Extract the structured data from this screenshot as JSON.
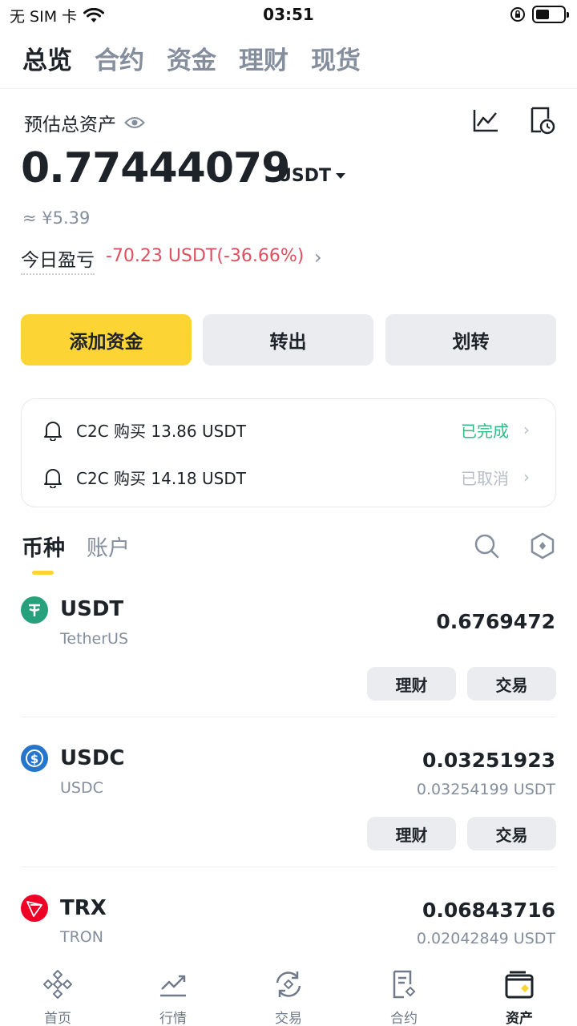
{
  "status_bar": {
    "carrier": "无 SIM 卡",
    "time": "03:51"
  },
  "top_tabs": [
    {
      "label": "总览",
      "active": true
    },
    {
      "label": "合约",
      "active": false
    },
    {
      "label": "资金",
      "active": false
    },
    {
      "label": "理财",
      "active": false
    },
    {
      "label": "现货",
      "active": false
    }
  ],
  "overview": {
    "estimated_label": "预估总资产",
    "total_amount": "0.77444079",
    "unit": "USDT",
    "approx_cny": "≈ ¥5.39",
    "today_pnl_label": "今日盈亏",
    "today_pnl_value": "-70.23 USDT(-36.66%)"
  },
  "actions": {
    "add_funds": "添加资金",
    "withdraw": "转出",
    "transfer": "划转"
  },
  "notices": [
    {
      "text": "C2C 购买 13.86 USDT",
      "status": "已完成",
      "status_color": "#2ebd85"
    },
    {
      "text": "C2C 购买 14.18 USDT",
      "status": "已取消",
      "status_color": "#b7bdc6"
    }
  ],
  "section_tabs": {
    "coins": "币种",
    "accounts": "账户"
  },
  "coins": [
    {
      "symbol": "USDT",
      "name": "TetherUS",
      "balance": "0.6769472",
      "value": "",
      "earn": "理财",
      "trade": "交易",
      "color": "#26a17b"
    },
    {
      "symbol": "USDC",
      "name": "USDC",
      "balance": "0.03251923",
      "value": "0.03254199 USDT",
      "earn": "理财",
      "trade": "交易",
      "color": "#2775ca"
    },
    {
      "symbol": "TRX",
      "name": "TRON",
      "balance": "0.06843716",
      "value": "0.02042849 USDT",
      "color": "#ef0027"
    }
  ],
  "bottom_nav": [
    {
      "label": "首页",
      "icon": "home-icon"
    },
    {
      "label": "行情",
      "icon": "market-chart-icon"
    },
    {
      "label": "交易",
      "icon": "trade-swap-icon"
    },
    {
      "label": "合约",
      "icon": "futures-doc-icon"
    },
    {
      "label": "资产",
      "icon": "wallet-icon",
      "active": true
    }
  ],
  "colors": {
    "accent": "#fcd535",
    "loss": "#e04f5f",
    "gain": "#2ebd85",
    "text_muted": "#848e9c"
  }
}
